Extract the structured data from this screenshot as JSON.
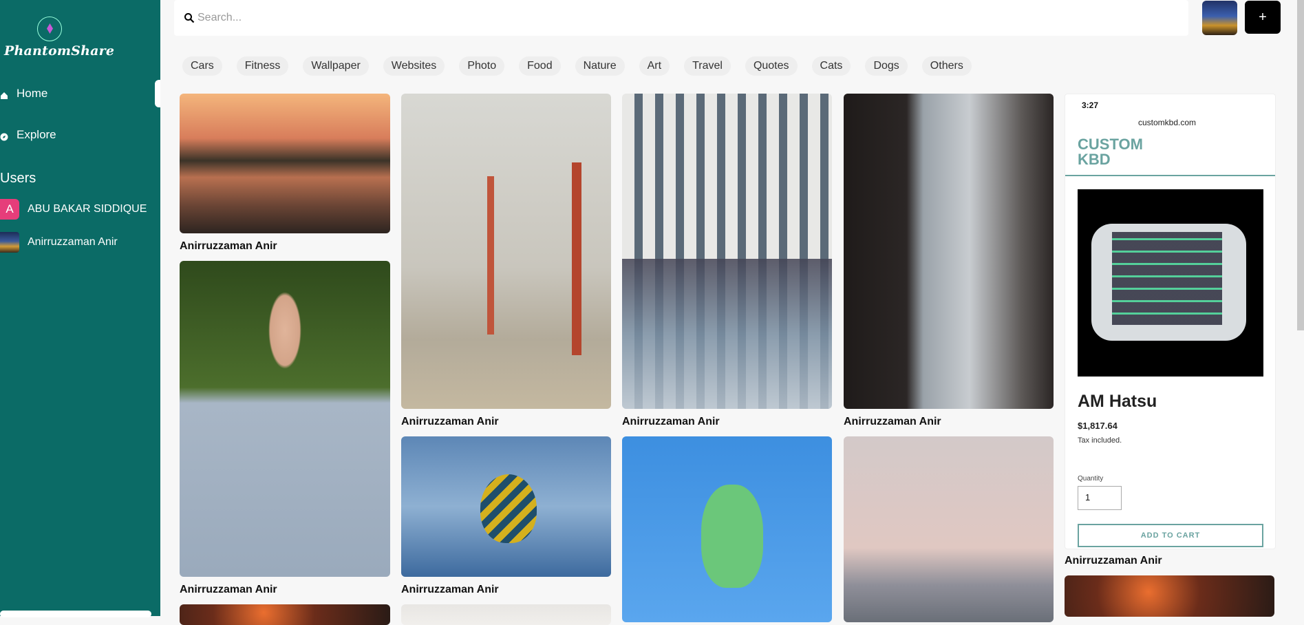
{
  "app": {
    "logo_text": "PhantomShare"
  },
  "sidebar": {
    "nav": [
      {
        "label": "Home",
        "icon": "home-icon",
        "active": true
      },
      {
        "label": "Explore",
        "icon": "compass-icon",
        "active": false
      }
    ],
    "users_heading": "Users",
    "users": [
      {
        "name": "ABU BAKAR SIDDIQUE",
        "initial": "A"
      },
      {
        "name": "Anirruzzaman Anir",
        "initial": ""
      }
    ]
  },
  "search": {
    "placeholder": "Search..."
  },
  "actions": {
    "add_label": "+"
  },
  "categories": [
    "Cars",
    "Fitness",
    "Wallpaper",
    "Websites",
    "Photo",
    "Food",
    "Nature",
    "Art",
    "Travel",
    "Quotes",
    "Cats",
    "Dogs",
    "Others"
  ],
  "pins": [
    {
      "author": "Anirruzzaman Anir",
      "image": "lake-sunset-swan"
    },
    {
      "author": "Anirruzzaman Anir",
      "image": "man-portrait"
    },
    {
      "author": "Anirruzzaman Anir",
      "image": "golden-gate-bridge"
    },
    {
      "author": "Anirruzzaman Anir",
      "image": "hot-air-balloon"
    },
    {
      "author": "Anirruzzaman Anir",
      "image": "building-reflection"
    },
    {
      "author": "Anirruzzaman Anir",
      "image": "turtle-balloon"
    },
    {
      "author": "Anirruzzaman Anir",
      "image": "city-street"
    },
    {
      "author": "Anirruzzaman Anir",
      "image": "sea-horizon"
    },
    {
      "author": "Anirruzzaman Anir",
      "image": "phone-screenshot-keyboard"
    }
  ],
  "phone_screenshot": {
    "time": "3:27",
    "url": "customkbd.com",
    "brand_line1": "CUSTOM",
    "brand_line2": "KBD",
    "product_name": "AM Hatsu",
    "price": "$1,817.64",
    "tax_note": "Tax included.",
    "quantity_label": "Quantity",
    "quantity_value": "1",
    "cart_button": "ADD TO CART"
  }
}
